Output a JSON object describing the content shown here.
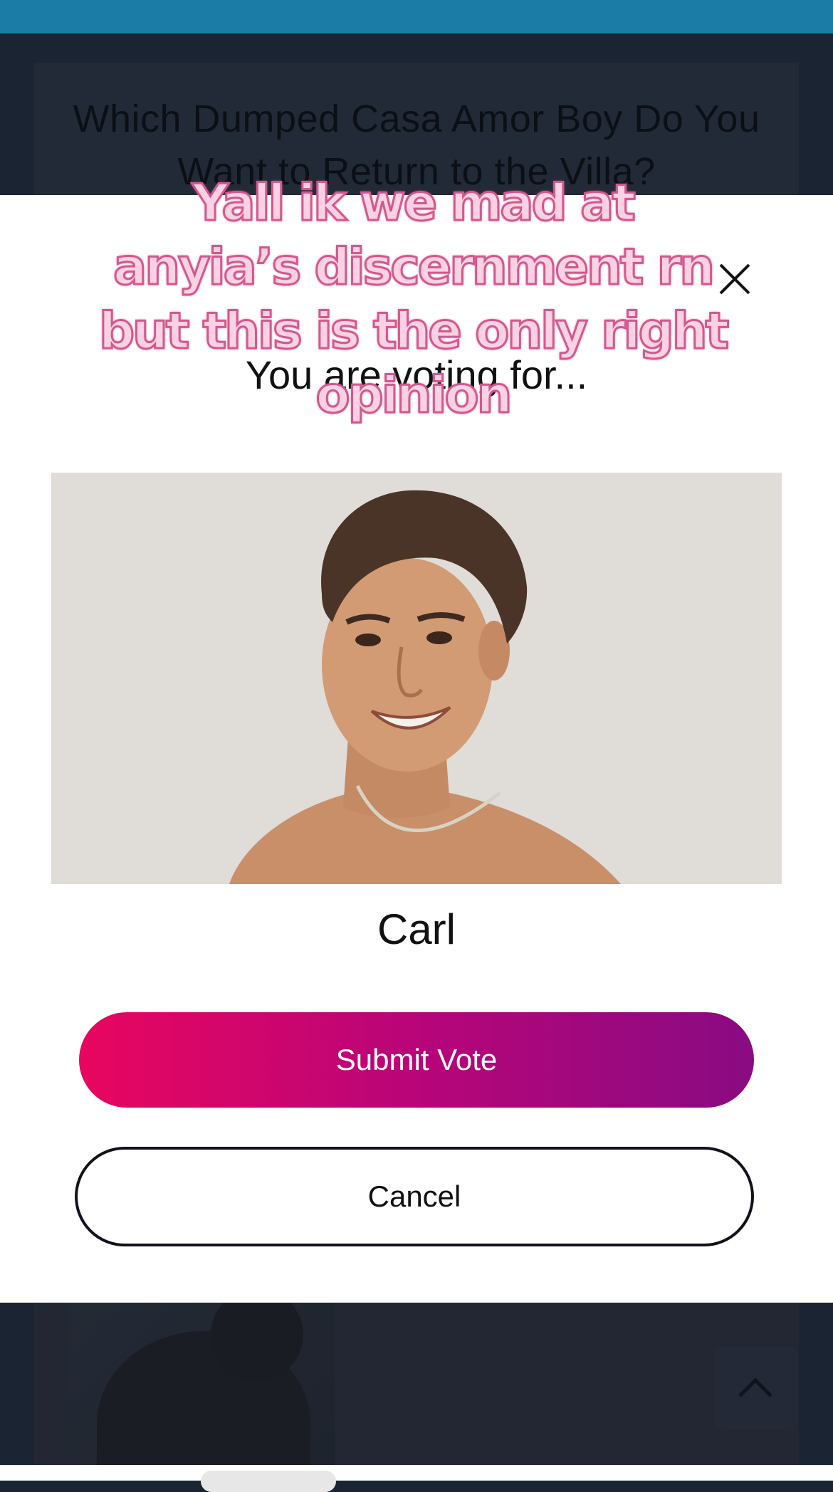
{
  "background_page": {
    "title": "Which Dumped Casa Amor Boy Do You Want to Return to the Villa?"
  },
  "modal": {
    "prompt": "You are voting for...",
    "candidate_name": "Carl",
    "submit_label": "Submit Vote",
    "cancel_label": "Cancel"
  },
  "overlay_caption": "Yall ik we mad at anyia’s discernment rn but this is the only right opinion",
  "icons": [
    "close-icon",
    "chevron-up-icon"
  ],
  "colors": {
    "top_bar": "#1b7da5",
    "submit_gradient_start": "#e8065f",
    "submit_gradient_end": "#890b82",
    "caption_fill": "#fbd2e4",
    "caption_stroke": "#d4588e"
  }
}
